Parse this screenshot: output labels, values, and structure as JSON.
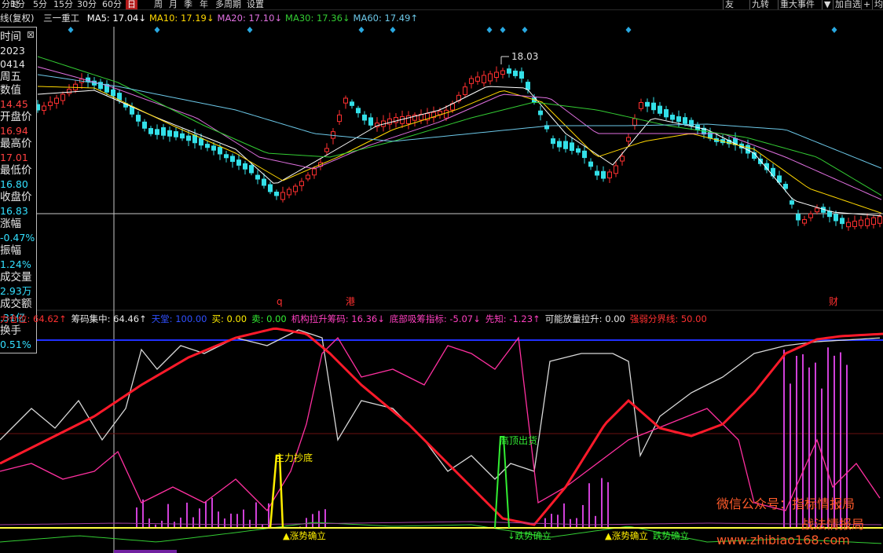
{
  "toolbar": {
    "left_items": [
      "分时",
      "1分",
      "5分",
      "15分",
      "30分",
      "60分",
      "日",
      "周",
      "月",
      "季",
      "年",
      "多周期",
      "设置"
    ],
    "selected": "日",
    "right_items": [
      "友",
      "九转",
      "重大事件",
      "▼",
      "加自选",
      "+",
      "均线"
    ]
  },
  "ma_bar": {
    "title": "线(复权)",
    "stock": "三一重工",
    "items": [
      {
        "label": "MA5:",
        "value": "17.04",
        "arrow": "↓",
        "color": "#ffffff"
      },
      {
        "label": "MA10:",
        "value": "17.19",
        "arrow": "↓",
        "color": "#ffd700"
      },
      {
        "label": "MA20:",
        "value": "17.10",
        "arrow": "↓",
        "color": "#e070e0"
      },
      {
        "label": "MA30:",
        "value": "17.36",
        "arrow": "↓",
        "color": "#33cc33"
      },
      {
        "label": "MA60:",
        "value": "17.49",
        "arrow": "↑",
        "color": "#6cc8e8"
      }
    ]
  },
  "info_panel": {
    "rows": [
      {
        "label": "时间",
        "value": "2023"
      },
      {
        "label": "",
        "value": "0414",
        "white": true
      },
      {
        "label": "周五",
        "value": ""
      },
      {
        "label": "数值",
        "value": "14.45",
        "color": "#ff4040"
      },
      {
        "label": "开盘价",
        "value": "16.94",
        "color": "#ff4040"
      },
      {
        "label": "最高价",
        "value": "17.01",
        "color": "#ff4040"
      },
      {
        "label": "最低价",
        "value": "16.80",
        "color": "#33e0ff"
      },
      {
        "label": "收盘价",
        "value": "16.83",
        "color": "#33e0ff"
      },
      {
        "label": "涨幅",
        "value": "-0.47%",
        "color": "#33e0ff"
      },
      {
        "label": "振幅",
        "value": "1.24%",
        "color": "#33e0ff"
      },
      {
        "label": "成交量",
        "value": "2.93万",
        "color": "#33e0ff"
      },
      {
        "label": "成交额",
        "value": ".31亿",
        "color": "#33e0ff"
      },
      {
        "label": "换手",
        "value": "0.51%",
        "color": "#33e0ff"
      }
    ]
  },
  "price_chart": {
    "peak_label": "18.03",
    "event_markers": [
      "q",
      "港",
      "财"
    ]
  },
  "indicator_bar": [
    {
      "text": "力仓位: 64.62↑",
      "color": "#ff3030"
    },
    {
      "text": "筹码集中: 64.46↑",
      "color": "#e8e8e8"
    },
    {
      "text": "天堂: 100.00",
      "color": "#3050ff"
    },
    {
      "text": "买: 0.00",
      "color": "#ffee00"
    },
    {
      "text": "卖: 0.00",
      "color": "#33ee33"
    },
    {
      "text": "机构拉升筹码: 16.36↓",
      "color": "#ff40c0"
    },
    {
      "text": "底部吸筹指标: -5.07↓",
      "color": "#ff40c0"
    },
    {
      "text": "先知: -1.23↑",
      "color": "#ff40c0"
    },
    {
      "text": "可能放量拉升: 0.00",
      "color": "#e8e8e8"
    },
    {
      "text": "强弱分界线: 50.00",
      "color": "#ff3030"
    }
  ],
  "signals": {
    "buy_bottom": "主力抄底",
    "sell_top": "高顶出货",
    "trend_up_1": "▲涨势确立",
    "trend_down_1": "↓跌势确立",
    "trend_up_2": "▲涨势确立",
    "trend_down_2": "跌势确立"
  },
  "watermark": {
    "line1": "微信公众号：指标情报局",
    "line2": "战法情报局",
    "url": "www.zhibiao168.com"
  }
}
